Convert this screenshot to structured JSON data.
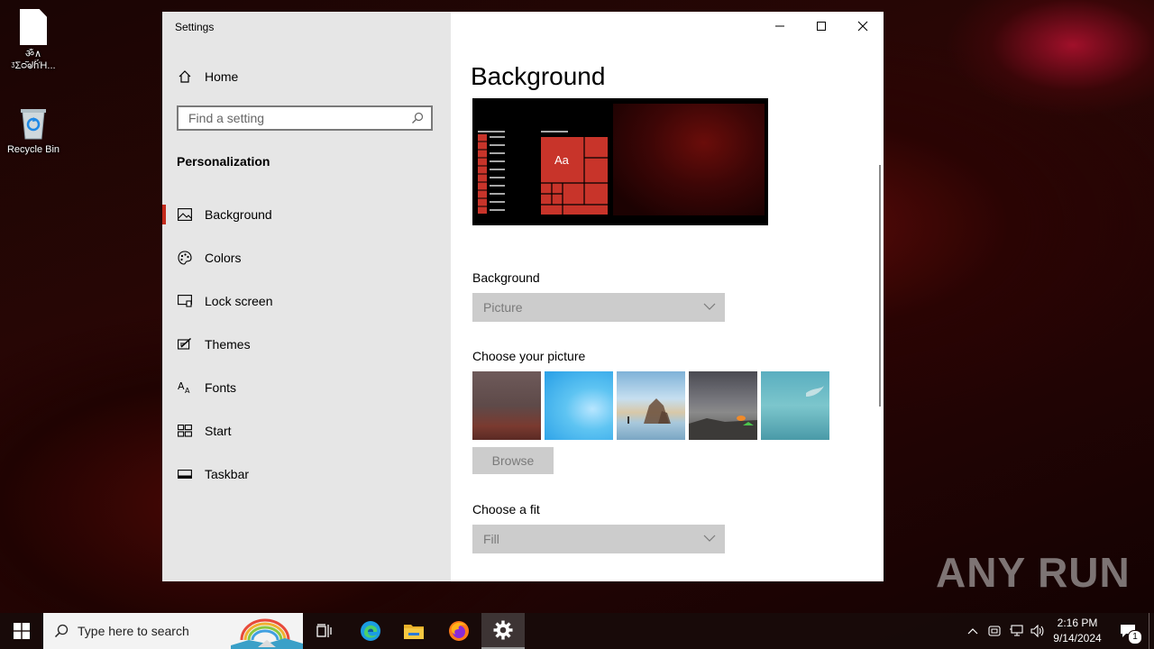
{
  "desktop": {
    "icons": [
      {
        "label": "ॐ∧\nᶾΣᴑ᷉ᖙɦ̈́Ή..."
      },
      {
        "label": "Recycle Bin"
      }
    ]
  },
  "window": {
    "title": "Settings",
    "home_label": "Home",
    "search_placeholder": "Find a setting",
    "section": "Personalization",
    "nav": [
      {
        "label": "Background",
        "icon": "picture-icon",
        "active": true
      },
      {
        "label": "Colors",
        "icon": "palette-icon"
      },
      {
        "label": "Lock screen",
        "icon": "lock-screen-icon"
      },
      {
        "label": "Themes",
        "icon": "themes-icon"
      },
      {
        "label": "Fonts",
        "icon": "fonts-icon"
      },
      {
        "label": "Start",
        "icon": "start-icon"
      },
      {
        "label": "Taskbar",
        "icon": "taskbar-icon"
      }
    ],
    "content": {
      "title": "Background",
      "preview_sample": "Aa",
      "background_label": "Background",
      "background_value": "Picture",
      "choose_picture_label": "Choose your picture",
      "browse_label": "Browse",
      "fit_label": "Choose a fit",
      "fit_value": "Fill"
    }
  },
  "taskbar": {
    "search_text": "Type here to search",
    "time": "2:16 PM",
    "date": "9/14/2024",
    "notification_count": "1"
  },
  "watermark": "ANY RUN",
  "colors": {
    "accent": "#c42b1c",
    "sidebar_bg": "#e6e6e6",
    "disabled_control": "#cccccc"
  }
}
